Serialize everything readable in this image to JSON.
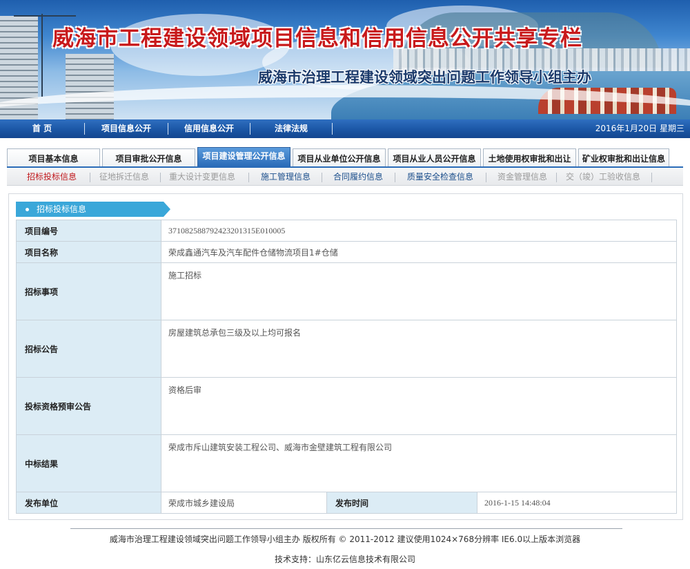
{
  "banner": {
    "title": "威海市工程建设领域项目信息和信用信息公开共享专栏",
    "subtitle": "威海市治理工程建设领域突出问题工作领导小组主办"
  },
  "main_nav": {
    "items": [
      "首 页",
      "项目信息公开",
      "信用信息公开",
      "法律法规"
    ],
    "date": "2016年1月20日 星期三"
  },
  "tabs": {
    "items": [
      "项目基本信息",
      "项目审批公开信息",
      "项目建设管理公开信息",
      "项目从业单位公开信息",
      "项目从业人员公开信息",
      "土地使用权审批和出让",
      "矿业权审批和出让信息"
    ],
    "active_index": 2
  },
  "sub_nav": {
    "items": [
      "招标投标信息",
      "征地拆迁信息",
      "重大设计变更信息",
      "施工管理信息",
      "合同履约信息",
      "质量安全检查信息",
      "资金管理信息",
      "交（竣）工验收信息"
    ],
    "active_index": 0
  },
  "section": {
    "title": "招标投标信息"
  },
  "details": {
    "project_no_label": "项目编号",
    "project_no": "371082588792423201315E010005",
    "project_name_label": "项目名称",
    "project_name": "荣成鑫通汽车及汽车配件仓储物流项目1#仓储",
    "bid_item_label": "招标事项",
    "bid_item": "施工招标",
    "bid_notice_label": "招标公告",
    "bid_notice": "房屋建筑总承包三级及以上均可报名",
    "prequal_label": "投标资格预审公告",
    "prequal": "资格后审",
    "result_label": "中标结果",
    "result": "荣成市斥山建筑安装工程公司、威海市金壁建筑工程有限公司",
    "publisher_label": "发布单位",
    "publisher": "荣成市城乡建设局",
    "publish_time_label": "发布时间",
    "publish_time": "2016-1-15 14:48:04"
  },
  "footer": {
    "line1": "威海市治理工程建设领域突出问题工作领导小组主办  版权所有  © 2011-2012 建议使用1024×768分辨率  IE6.0以上版本浏览器",
    "line2": "技术支持：山东亿云信息技术有限公司"
  }
}
